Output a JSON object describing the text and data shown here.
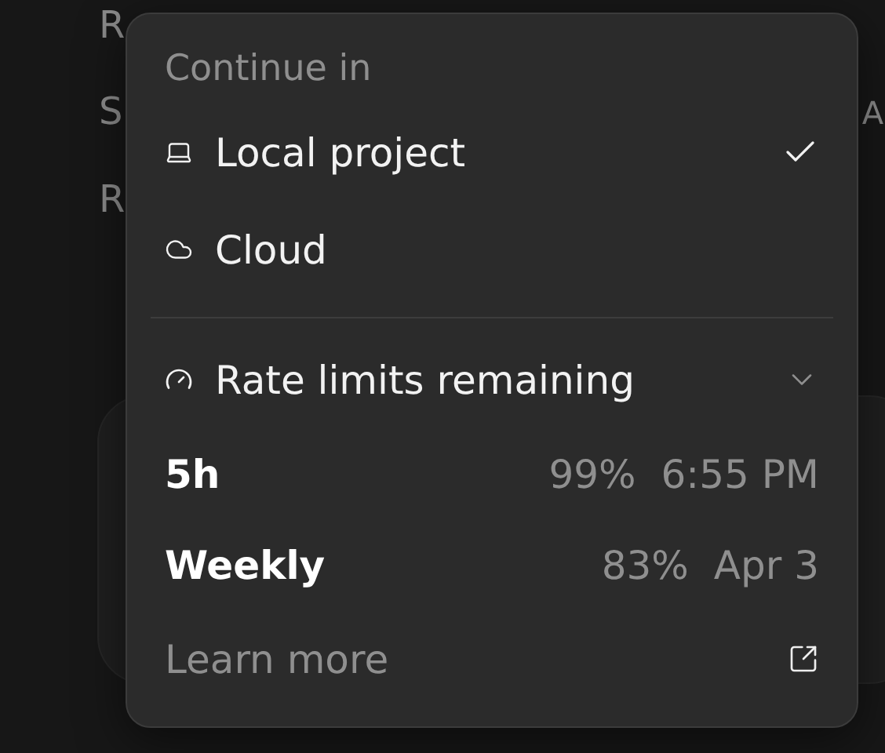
{
  "background": {
    "letters": [
      "R",
      "S",
      "R"
    ],
    "edge_letter": "A"
  },
  "menu": {
    "header": "Continue in",
    "options": [
      {
        "label": "Local project",
        "kind": "laptop",
        "selected": true
      },
      {
        "label": "Cloud",
        "kind": "cloud",
        "selected": false
      }
    ],
    "rate_limits": {
      "label": "Rate limits remaining",
      "expanded": true,
      "rows": [
        {
          "name": "5h",
          "percent": "99%",
          "reset": "6:55 PM"
        },
        {
          "name": "Weekly",
          "percent": "83%",
          "reset": "Apr 3"
        }
      ]
    },
    "learn_more": "Learn more"
  }
}
